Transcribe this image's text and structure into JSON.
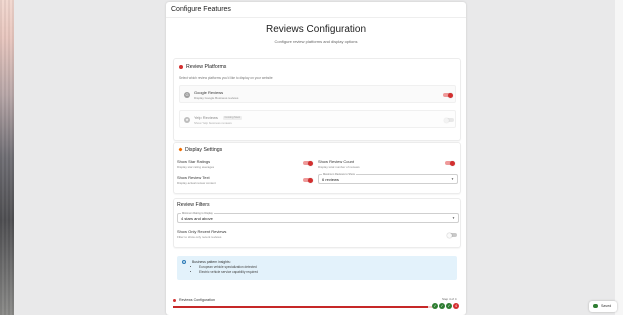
{
  "panel": {
    "header_title": "Configure Features"
  },
  "page": {
    "title": "Reviews Configuration",
    "subtitle": "Configure review platforms and display options"
  },
  "platforms": {
    "title": "Review Platforms",
    "hint": "Select which review platforms you'd like to display on your website",
    "items": [
      {
        "name": "Google Reviews",
        "desc": "Display Google Business reviews",
        "enabled": true
      },
      {
        "name": "Yelp Reviews",
        "badge": "Coming Soon",
        "desc": "Show Yelp business reviews",
        "enabled": false
      }
    ]
  },
  "display": {
    "title": "Display Settings",
    "star_ratings": {
      "label": "Show Star Ratings",
      "desc": "Display star rating averages",
      "enabled": true
    },
    "review_count": {
      "label": "Show Review Count",
      "desc": "Display total number of reviews",
      "enabled": true
    },
    "review_text": {
      "label": "Show Review Text",
      "desc": "Display actual review content",
      "enabled": true
    },
    "max_reviews": {
      "label": "Maximum Reviews to Show",
      "value": "6 reviews"
    }
  },
  "filters": {
    "title": "Review Filters",
    "min_rating": {
      "label": "Minimum Rating to Display",
      "value": "4 stars and above"
    },
    "recent_only": {
      "label": "Show Only Recent Reviews",
      "desc": "Filter to show only recent reviews",
      "enabled": false
    }
  },
  "insights": {
    "title": "Business pattern insights:",
    "items": [
      "European vehicle specialization detected",
      "Electric vehicle service capability required"
    ]
  },
  "progress": {
    "label": "Reviews Configuration",
    "step_text": "Step 4 of 4",
    "fraction": 0.97,
    "steps": [
      "✓",
      "✓",
      "✓",
      "4"
    ]
  },
  "saved": {
    "label": "Saved"
  },
  "colors": {
    "accent": "#d32f2f",
    "accent_light": "#ef9a9a",
    "step_done": "#2e7d32",
    "info_bg": "#e3f2fb"
  }
}
